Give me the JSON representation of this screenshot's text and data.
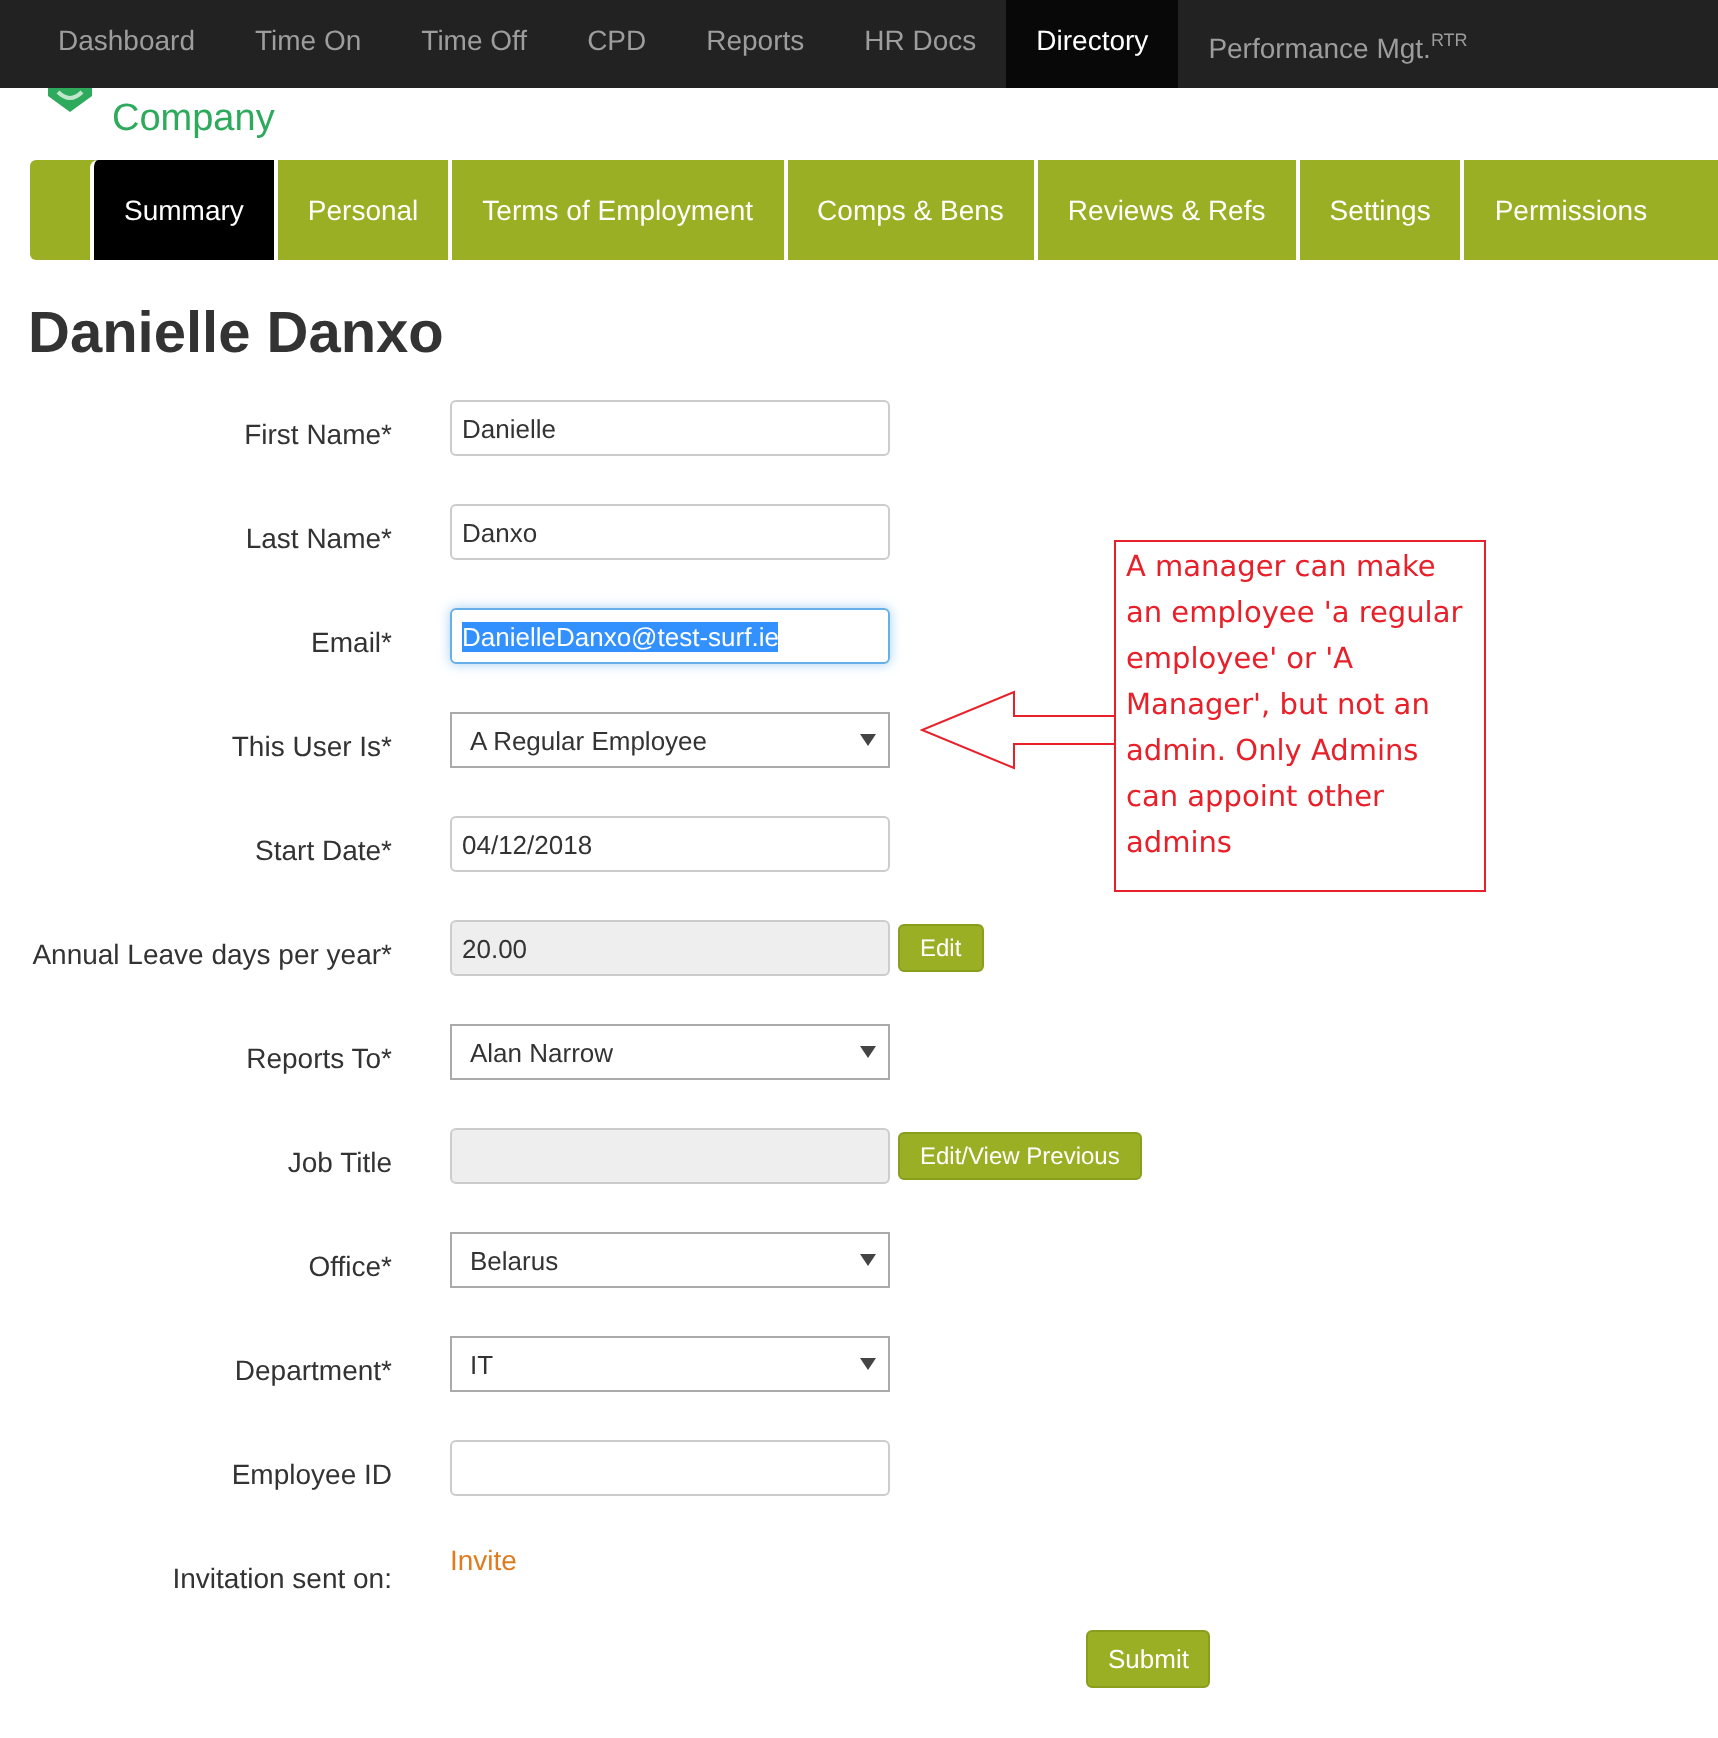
{
  "top_nav": [
    {
      "label": "Dashboard",
      "selected": false
    },
    {
      "label": "Time On",
      "selected": false
    },
    {
      "label": "Time Off",
      "selected": false
    },
    {
      "label": "CPD",
      "selected": false
    },
    {
      "label": "Reports",
      "selected": false
    },
    {
      "label": "HR Docs",
      "selected": false
    },
    {
      "label": "Directory",
      "selected": true
    },
    {
      "label": "Performance Mgt.$^{RTR}$",
      "selected": false
    }
  ],
  "logo": {
    "text": "Company"
  },
  "tabs": [
    {
      "label": "Summary",
      "selected": true
    },
    {
      "label": "Personal",
      "selected": false
    },
    {
      "label": "Terms of Employment",
      "selected": false
    },
    {
      "label": "Comps & Bens",
      "selected": false
    },
    {
      "label": "Reviews & Refs",
      "selected": false
    },
    {
      "label": "Settings",
      "selected": false
    },
    {
      "label": "Permissions",
      "selected": false
    }
  ],
  "title": "Danielle Danxo",
  "fields": [
    {
      "label": "First Name*",
      "kind": "text",
      "value": "Danielle"
    },
    {
      "label": "Last Name*",
      "kind": "text",
      "value": "Danxo"
    },
    {
      "label": "Email*",
      "kind": "text",
      "value": "DanielleDanxo@test-surf.ie",
      "selected": true
    },
    {
      "label": "This User Is*",
      "kind": "select",
      "value": "A Regular Employee"
    },
    {
      "label": "Start Date*",
      "kind": "text",
      "value": "04/12/2018"
    },
    {
      "label": "Annual Leave days per year*",
      "kind": "readonly",
      "value": "20.00",
      "button": "Edit"
    },
    {
      "label": "Reports To*",
      "kind": "select",
      "value": "Alan Narrow"
    },
    {
      "label": "Job Title",
      "kind": "readonly",
      "button": "Edit/View Previous"
    },
    {
      "label": "Office*",
      "kind": "select",
      "value": "Belarus"
    },
    {
      "label": "Department*",
      "kind": "select",
      "value": "IT"
    },
    {
      "label": "Employee ID",
      "kind": "text"
    },
    {
      "label": "Invitation sent on:",
      "kind": "link",
      "value": "Invite"
    }
  ],
  "submit": "Submit",
  "callout": {
    "text": "A manager can make an employee 'a regular employee' or 'A Manager', but not an admin. Only Admins can appoint other admins"
  }
}
